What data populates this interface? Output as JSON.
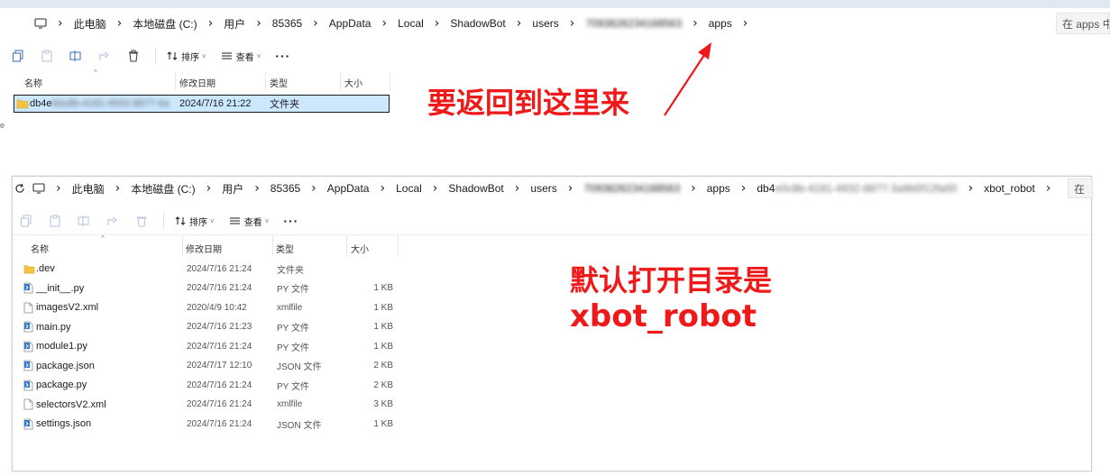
{
  "top_window": {
    "breadcrumb": [
      "此电脑",
      "本地磁盘 (C:)",
      "用户",
      "85365",
      "AppData",
      "Local",
      "ShadowBot",
      "users",
      "7093826234168563",
      "apps"
    ],
    "search_placeholder": "在 apps 中",
    "toolbar": {
      "sort_label": "排序",
      "view_label": "查看"
    },
    "columns": {
      "name": "名称",
      "date": "修改日期",
      "type": "类型",
      "size": "大小"
    },
    "rows": [
      {
        "name_visible": "db4e",
        "name_blurred": "b0c8b-4181-4932-8877-6a",
        "date": "2024/7/16 21:22",
        "type": "文件夹",
        "size": ""
      }
    ],
    "left_edge_glyphs": [
      "e"
    ]
  },
  "second_window": {
    "breadcrumb": [
      "此电脑",
      "本地磁盘 (C:)",
      "用户",
      "85365",
      "AppData",
      "Local",
      "ShadowBot",
      "users",
      "7093826234168563",
      "apps",
      "xbot_robot"
    ],
    "breadcrumb_partial": {
      "visible": "db4",
      "blurred": "e0c8b-4181-4932-8877-3a9b0f12fa00"
    },
    "search_placeholder": "在",
    "toolbar": {
      "sort_label": "排序",
      "view_label": "查看"
    },
    "columns": {
      "name": "名称",
      "date": "修改日期",
      "type": "类型",
      "size": "大小"
    },
    "rows": [
      {
        "name": ".dev",
        "date": "2024/7/16 21:24",
        "type": "文件夹",
        "size": "",
        "icon": "folder-icon"
      },
      {
        "name": "__init__.py",
        "date": "2024/7/16 21:24",
        "type": "PY 文件",
        "size": "1 KB",
        "icon": "python-file-icon"
      },
      {
        "name": "imagesV2.xml",
        "date": "2020/4/9 10:42",
        "type": "xmlfile",
        "size": "1 KB",
        "icon": "file-icon"
      },
      {
        "name": "main.py",
        "date": "2024/7/16 21:23",
        "type": "PY 文件",
        "size": "1 KB",
        "icon": "python-file-icon"
      },
      {
        "name": "module1.py",
        "date": "2024/7/16 21:24",
        "type": "PY 文件",
        "size": "1 KB",
        "icon": "python-file-icon"
      },
      {
        "name": "package.json",
        "date": "2024/7/17 12:10",
        "type": "JSON 文件",
        "size": "2 KB",
        "icon": "python-file-icon"
      },
      {
        "name": "package.py",
        "date": "2024/7/16 21:24",
        "type": "PY 文件",
        "size": "2 KB",
        "icon": "python-file-icon"
      },
      {
        "name": "selectorsV2.xml",
        "date": "2024/7/16 21:24",
        "type": "xmlfile",
        "size": "3 KB",
        "icon": "file-icon"
      },
      {
        "name": "settings.json",
        "date": "2024/7/16 21:24",
        "type": "JSON 文件",
        "size": "1 KB",
        "icon": "python-file-icon"
      }
    ]
  },
  "annotations": {
    "return_here": "要返回到这里来",
    "default_dir_line1": "默认打开目录是",
    "default_dir_line2": "xbot_robot",
    "color": "#f01919"
  },
  "colors": {
    "selection": "#cce8ff",
    "folder": "#f5c542",
    "py_icon": "#2a7ad6"
  }
}
